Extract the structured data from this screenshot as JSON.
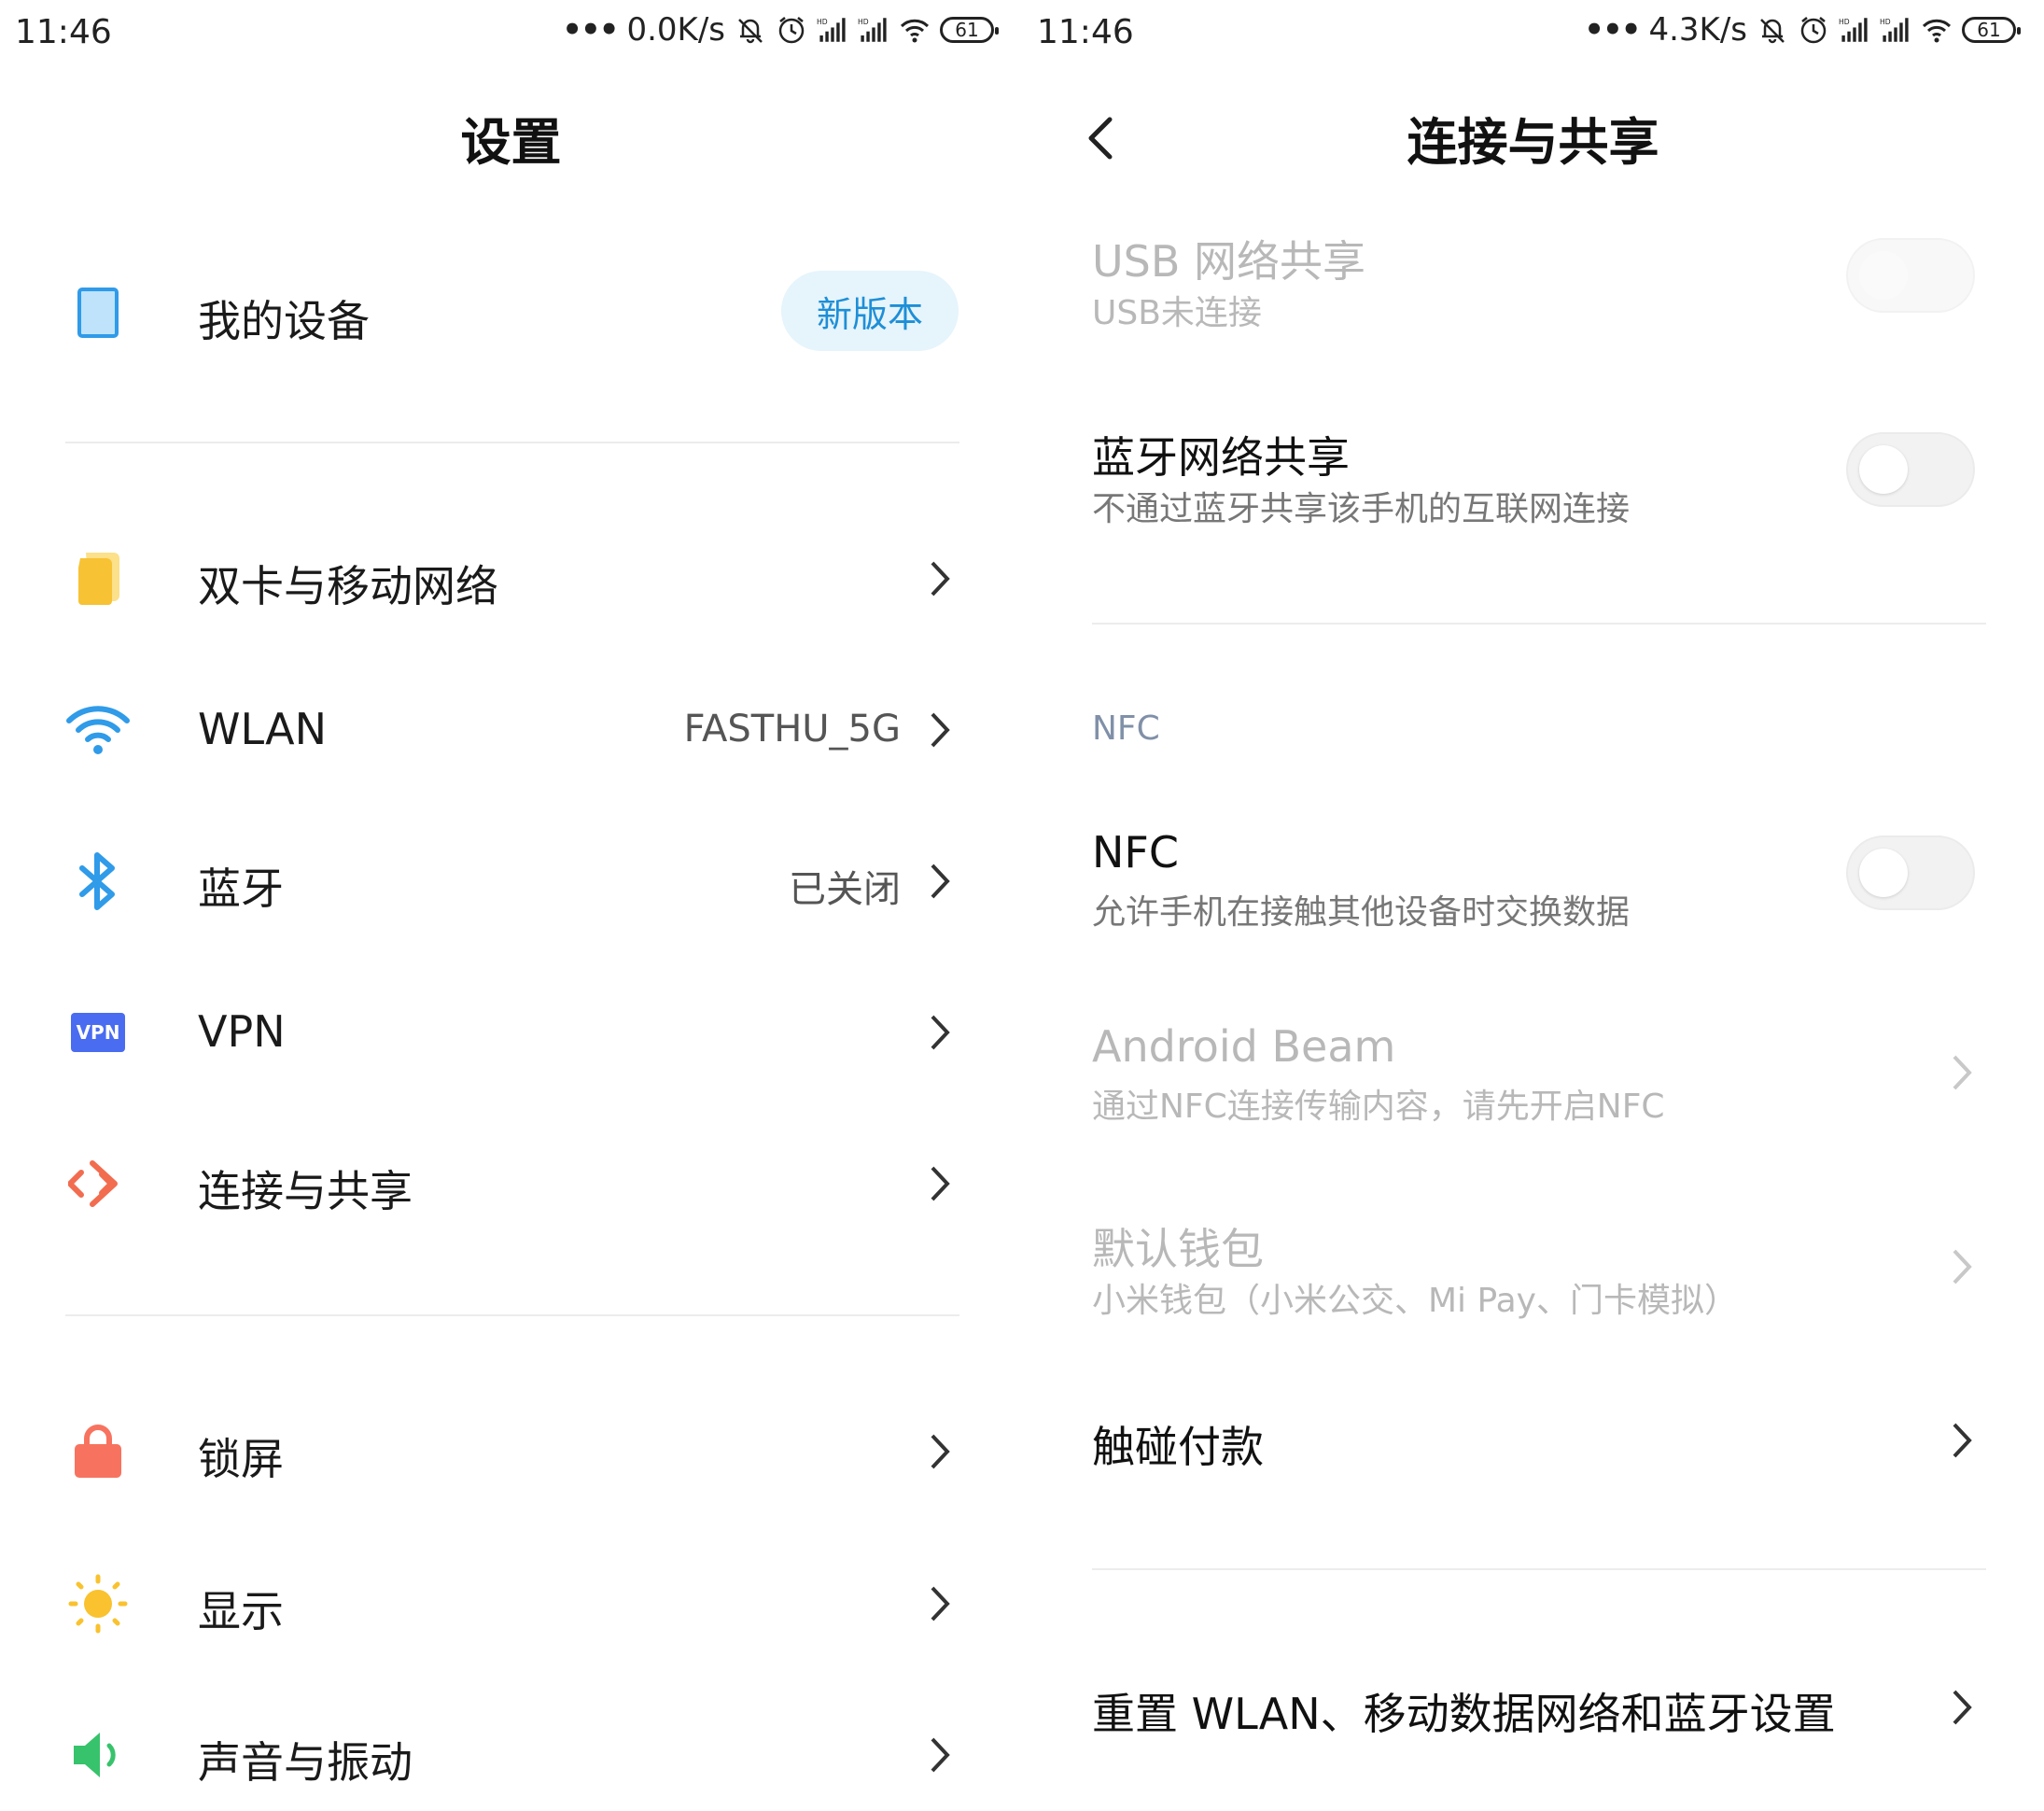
{
  "left": {
    "status": {
      "time": "11:46",
      "net": "0.0K/s",
      "battery": "61"
    },
    "title": "设置",
    "device": {
      "label": "我的设备",
      "badge": "新版本"
    },
    "items": [
      {
        "label": "双卡与移动网络",
        "value": ""
      },
      {
        "label": "WLAN",
        "value": "FASTHU_5G"
      },
      {
        "label": "蓝牙",
        "value": "已关闭"
      },
      {
        "label": "VPN",
        "value": "",
        "icon_text": "VPN"
      },
      {
        "label": "连接与共享",
        "value": ""
      },
      {
        "label": "锁屏",
        "value": ""
      },
      {
        "label": "显示",
        "value": ""
      },
      {
        "label": "声音与振动",
        "value": ""
      }
    ]
  },
  "right": {
    "status": {
      "time": "11:46",
      "net": "4.3K/s",
      "battery": "61"
    },
    "title": "连接与共享",
    "usb": {
      "title": "USB 网络共享",
      "sub": "USB未连接",
      "on": false,
      "enabled": false
    },
    "bt": {
      "title": "蓝牙网络共享",
      "sub": "不通过蓝牙共享该手机的互联网连接",
      "on": false
    },
    "nfc_header": "NFC",
    "nfc": {
      "title": "NFC",
      "sub": "允许手机在接触其他设备时交换数据",
      "on": false
    },
    "beam": {
      "title": "Android Beam",
      "sub": "通过NFC连接传输内容，请先开启NFC"
    },
    "wallet": {
      "title": "默认钱包",
      "sub": "小米钱包（小米公交、Mi Pay、门卡模拟）"
    },
    "touch_pay": {
      "title": "触碰付款"
    },
    "reset": {
      "title": "重置 WLAN、移动数据网络和蓝牙设置"
    }
  },
  "colors": {
    "accent_blue": "#2f9be9",
    "sim_yellow": "#f7c233",
    "vpn_blue": "#4a6cf0",
    "connect_orange": "#f26c4f",
    "lock_red": "#f7735f",
    "sun_yellow": "#f9c22e",
    "sound_green": "#37c36b"
  }
}
